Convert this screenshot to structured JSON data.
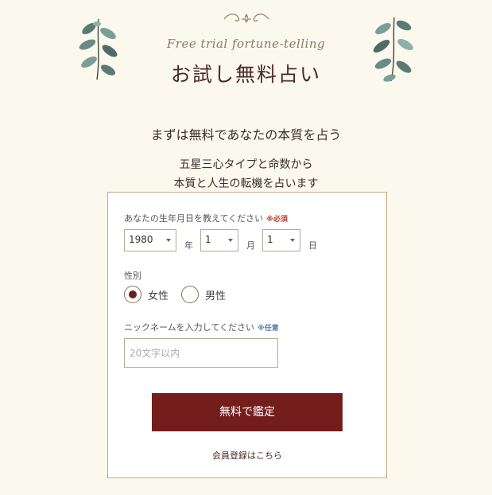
{
  "header": {
    "script_title": "Free trial fortune-telling",
    "title": "お試し無料占い"
  },
  "intro": {
    "lead": "まずは無料であなたの本質を占う",
    "sub_line1": "五星三心タイプと命数から",
    "sub_line2": "本質と人生の転機を占います"
  },
  "form": {
    "birth_label": "あなたの生年月日を教えてください",
    "required_tag": "※必須",
    "year_value": "1980",
    "year_unit": "年",
    "month_value": "1",
    "month_unit": "月",
    "day_value": "1",
    "day_unit": "日",
    "gender_label": "性別",
    "gender_female": "女性",
    "gender_male": "男性",
    "gender_selected": "女性",
    "nickname_label": "ニックネームを入力してください",
    "optional_tag": "※任意",
    "nickname_placeholder": "20文字以内",
    "submit_label": "無料で鑑定",
    "register_link": "会員登録はこちら"
  },
  "colors": {
    "background": "#fbf8ee",
    "accent": "#741d1d",
    "border": "#c4ab84"
  }
}
